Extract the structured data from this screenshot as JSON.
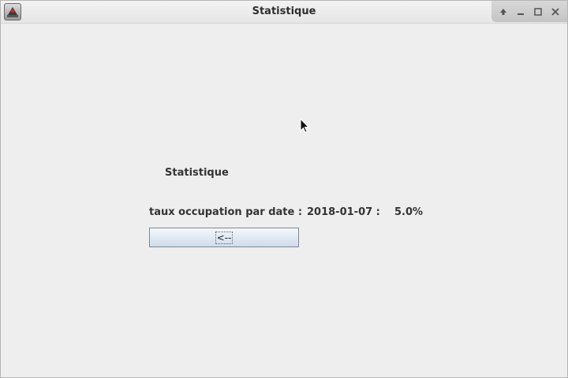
{
  "window": {
    "title": "Statistique",
    "icon": "java-app-icon",
    "controls": [
      "restore-icon",
      "minimize-icon",
      "maximize-icon",
      "close-icon"
    ]
  },
  "main": {
    "heading": "Statistique",
    "occupation_label": "taux occupation par date :",
    "date_value": "2018-01-07 :",
    "rate_value": "5.0%",
    "back_button_label": "<--"
  }
}
